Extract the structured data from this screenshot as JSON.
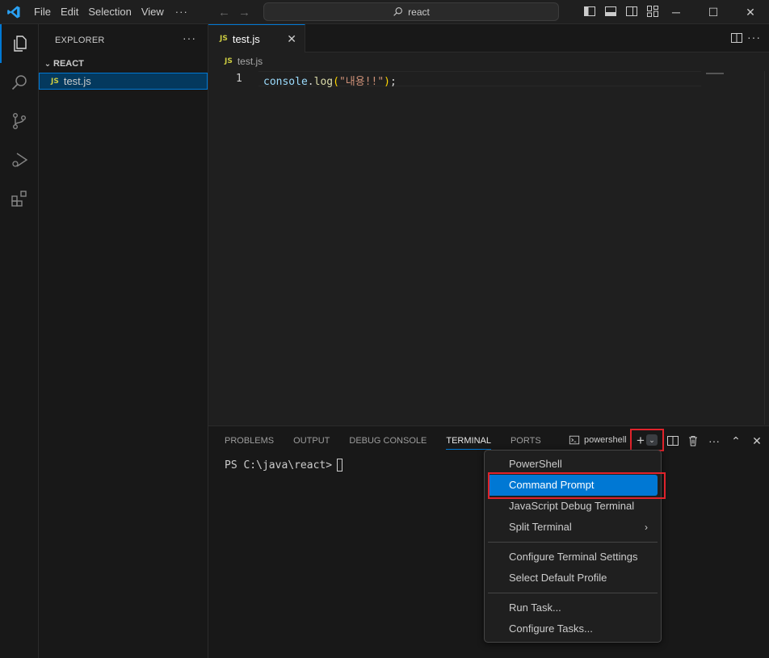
{
  "titlebar": {
    "menu": [
      "File",
      "Edit",
      "Selection",
      "View"
    ],
    "more": "···",
    "search": "react",
    "controls": {
      "minimize": "─",
      "maximize": "☐",
      "close": "✕"
    }
  },
  "sidebar": {
    "title": "EXPLORER",
    "more": "···",
    "folder": "REACT",
    "file": "test.js",
    "file_badge": "JS"
  },
  "editor": {
    "tab_label": "test.js",
    "tab_badge": "JS",
    "tab_close": "✕",
    "breadcrumb": "test.js",
    "breadcrumb_badge": "JS",
    "more": "···",
    "line_number": "1",
    "code": {
      "obj": "console",
      "dot": ".",
      "fn": "log",
      "paren_open": "(",
      "str": "\"내용!!\"",
      "paren_close": ")",
      "semi": ";"
    }
  },
  "panel": {
    "tabs": [
      "PROBLEMS",
      "OUTPUT",
      "DEBUG CONSOLE",
      "TERMINAL",
      "PORTS"
    ],
    "active_tab": "TERMINAL",
    "terminal_name": "powershell",
    "plus": "+",
    "dropdown_caret": "⌄",
    "prompt": "PS C:\\java\\react>",
    "icons": {
      "more": "···",
      "maximize": "⌃",
      "close": "✕"
    }
  },
  "dropdown": {
    "items": [
      "PowerShell",
      "Command Prompt",
      "JavaScript Debug Terminal",
      "Split Terminal",
      "Configure Terminal Settings",
      "Select Default Profile",
      "Run Task...",
      "Configure Tasks..."
    ],
    "selected": "Command Prompt",
    "submenu_arrow": "›"
  },
  "colors": {
    "accent": "#0078d4",
    "highlight": "#e0232b"
  }
}
